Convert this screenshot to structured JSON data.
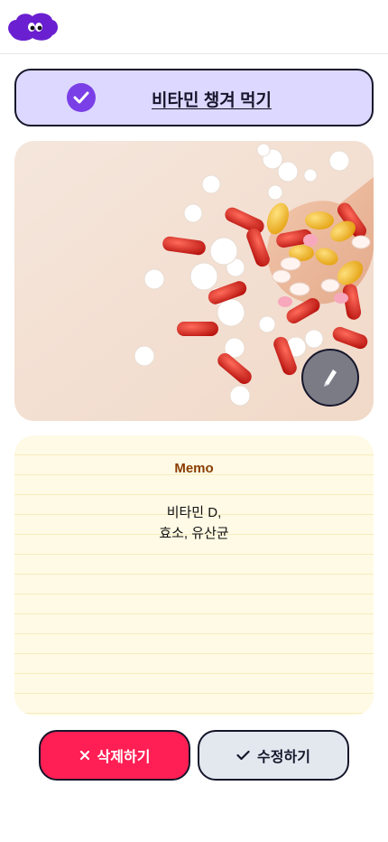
{
  "header": {
    "logo_icon": "blob-mascot-logo"
  },
  "task": {
    "title": "비타민 챙겨 먹기",
    "status_icon": "check-circle-icon",
    "accent": "#7a3fe6",
    "card_color": "#ddd8ff"
  },
  "photo": {
    "description_icon": "pills-photo",
    "edit_icon": "pencil-icon"
  },
  "memo": {
    "title": "Memo",
    "body": "비타민 D,\n효소, 유산균"
  },
  "actions": {
    "delete_label": "삭제하기",
    "delete_icon": "close-icon",
    "delete_color": "#ff1f54",
    "edit_label": "수정하기",
    "edit_icon": "check-icon",
    "edit_color": "#e3e8ef"
  }
}
